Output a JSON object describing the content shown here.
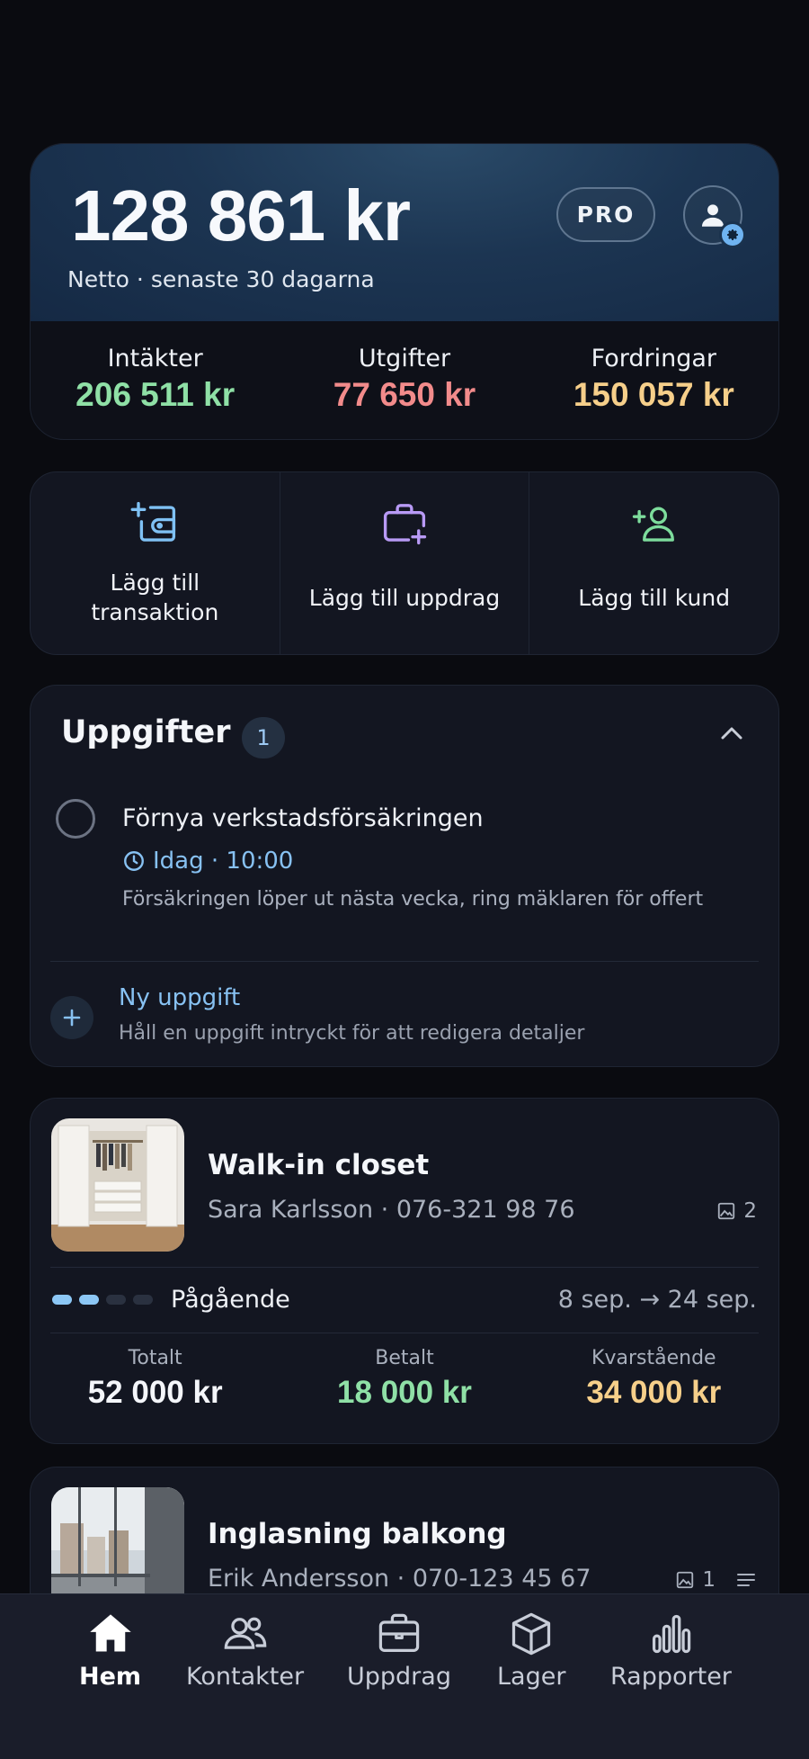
{
  "summary": {
    "net_amount": "128 861 kr",
    "net_subtitle": "Netto · senaste 30 dagarna",
    "pro_badge": "PRO",
    "stats": [
      {
        "label": "Intäkter",
        "value": "206 511 kr",
        "color": "#8fe0a6"
      },
      {
        "label": "Utgifter",
        "value": "77 650 kr",
        "color": "#f28b8b"
      },
      {
        "label": "Fordringar",
        "value": "150 057 kr",
        "color": "#f6cf8a"
      }
    ]
  },
  "actions": [
    {
      "label": "Lägg till transaktion",
      "icon": "receipt-add-icon",
      "color": "#7fc1f4"
    },
    {
      "label": "Lägg till uppdrag",
      "icon": "briefcase-add-icon",
      "color": "#b89af5"
    },
    {
      "label": "Lägg till kund",
      "icon": "person-add-icon",
      "color": "#7ddc9c"
    }
  ],
  "tasks": {
    "title": "Uppgifter",
    "count": "1",
    "items": [
      {
        "title": "Förnya verkstadsförsäkringen",
        "due": "Idag · 10:00",
        "note": "Försäkringen löper ut nästa vecka, ring mäklaren för offert"
      }
    ],
    "new_label": "Ny uppgift",
    "new_hint": "Håll en uppgift intryckt för att redigera detaljer"
  },
  "jobs": [
    {
      "title": "Walk-in closet",
      "customer": "Sara Karlsson",
      "phone": "076-321 98 76",
      "photos": "2",
      "progress": 2,
      "progress_total": 4,
      "status": "Pågående",
      "dates": "8 sep. → 24 sep.",
      "money": [
        {
          "label": "Totalt",
          "value": "52 000 kr",
          "color": "#f4f6fa"
        },
        {
          "label": "Betalt",
          "value": "18 000 kr",
          "color": "#8fe0a6"
        },
        {
          "label": "Kvarstående",
          "value": "34 000 kr",
          "color": "#f6cf8a"
        }
      ]
    },
    {
      "title": "Inglasning balkong",
      "customer": "Erik Andersson",
      "phone": "070-123 45 67",
      "photos": "1"
    }
  ],
  "nav": [
    {
      "label": "Hem",
      "icon": "home-icon",
      "active": true
    },
    {
      "label": "Kontakter",
      "icon": "contacts-icon",
      "active": false
    },
    {
      "label": "Uppdrag",
      "icon": "briefcase-icon",
      "active": false
    },
    {
      "label": "Lager",
      "icon": "box-icon",
      "active": false
    },
    {
      "label": "Rapporter",
      "icon": "bar-chart-icon",
      "active": false
    }
  ]
}
